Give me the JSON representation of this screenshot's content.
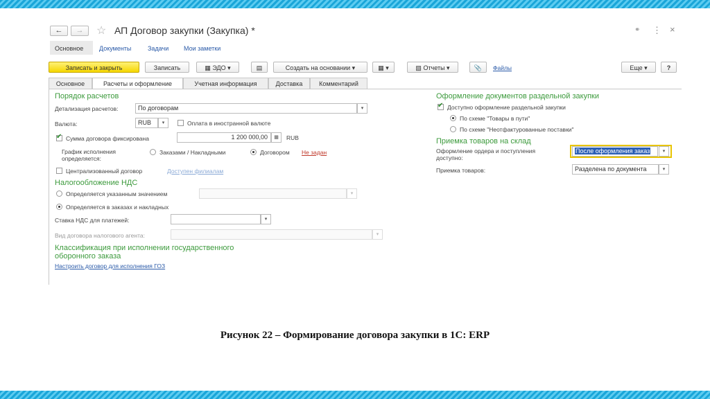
{
  "window": {
    "title": "АП Договор закупки (Закупка) *",
    "back_icon": "←",
    "fwd_icon": "→",
    "star_icon": "☆",
    "link_icon": "🔗",
    "menu_icon": "⋮",
    "close_icon": "×"
  },
  "nav": [
    "Основное",
    "Документы",
    "Задачи",
    "Мои заметки"
  ],
  "toolbar": {
    "save_close": "Записать и закрыть",
    "save": "Записать",
    "edo": "ЭДО",
    "create_based": "Создать на основании",
    "reports": "Отчеты",
    "files": "Файлы",
    "more": "Еще",
    "help": "?"
  },
  "tabs": [
    "Основное",
    "Расчеты и оформление",
    "Учетная информация",
    "Доставка",
    "Комментарий"
  ],
  "left": {
    "settlement_title": "Порядок расчетов",
    "detail_label": "Детализация расчетов:",
    "detail_value": "По договорам",
    "currency_label": "Валюта:",
    "currency_value": "RUB",
    "foreign_payment": "Оплата в иностранной валюте",
    "fixed_sum_label": "Сумма договора фиксирована",
    "fixed_sum_value": "1 200 000,00",
    "fixed_sum_currency": "RUB",
    "schedule_label_1": "График исполнения",
    "schedule_label_2": "определяется:",
    "schedule_orders": "Заказами / Накладными",
    "schedule_contract": "Договором",
    "schedule_link": "Не задан",
    "centralized": "Централизованный договор",
    "branches_link": "Доступен филиалам",
    "vat_title": "Налогообложение НДС",
    "vat_opt_value": "Определяется указанным значением",
    "vat_opt_orders": "Определяется в заказах и накладных",
    "vat_rate_label": "Ставка НДС для платежей:",
    "agent_label": "Вид договора налогового агента:",
    "gos_title_1": "Классификация при исполнении государственного",
    "gos_title_2": "оборонного заказа",
    "gos_link": "Настроить договор для исполнения ГОЗ"
  },
  "right": {
    "separate_title": "Оформление документов раздельной закупки",
    "separate_check": "Доступно оформление раздельной закупки",
    "scheme_transit": "По схеме \"Товары в пути\"",
    "scheme_unbilled": "По схеме \"Неотфактурованные поставки\"",
    "warehouse_title": "Приемка товаров на склад",
    "order_label_1": "Оформление ордера и поступления",
    "order_label_2": "доступно:",
    "order_value": "После оформления заказ",
    "acceptance_label": "Приемка товаров:",
    "acceptance_value": "Разделена по документа"
  },
  "caption": "Рисунок 22 – Формирование договора закупки в 1С: ERP",
  "colors": {
    "accent_green": "#3c9a3c",
    "link_blue": "#2a5aa8",
    "stripe": "#1aa6d9",
    "yellow": "#f5d600"
  }
}
